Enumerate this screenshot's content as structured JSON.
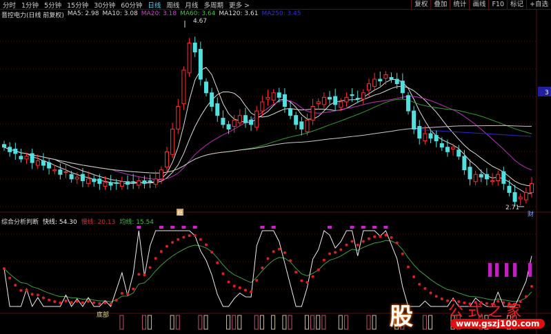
{
  "periods": [
    "分时",
    "1分钟",
    "5分钟",
    "15分钟",
    "30分钟",
    "60分钟",
    "日线",
    "周线",
    "月线",
    "多周期",
    "更多 >"
  ],
  "active_period": "日线",
  "right_tools": [
    "复权",
    "叠加",
    "统计",
    "画线",
    "F10",
    "标记",
    "+自选"
  ],
  "stock_title": "晋控电力(日线 前复权)",
  "ma": [
    {
      "label": "MA5: 2.98",
      "color": "#dddddd"
    },
    {
      "label": "MA10: 3.08",
      "color": "#dddddd"
    },
    {
      "label": "MA20: 3.18",
      "color": "#d040d0"
    },
    {
      "label": "MA60: 3.64",
      "color": "#40c040"
    },
    {
      "label": "MA120: 3.61",
      "color": "#dddddd"
    },
    {
      "label": "MA250: 3.45",
      "color": "#3030e0"
    }
  ],
  "high_label": "4.67",
  "low_label": "2.71",
  "axis_tag": "3",
  "cai_tag": "财",
  "event_tag": "稳",
  "indicator": {
    "name": "综合分析判断",
    "fast": "快线: 54.30",
    "slow": "慢线: 20.13",
    "avg": "均线: 15.54",
    "bottom_label": "底部"
  },
  "watermark": {
    "brand": "股",
    "title": "公式之家",
    "url": "www.gszj100.com"
  },
  "colors": {
    "up": "#ff3030",
    "down": "#50e0e0",
    "grid": "#5a1010"
  },
  "chart_data": {
    "type": "candlestick",
    "closes": [
      3.35,
      3.3,
      3.28,
      3.22,
      3.25,
      3.18,
      3.2,
      3.15,
      3.12,
      3.1,
      3.05,
      3.08,
      3.0,
      3.02,
      2.98,
      3.0,
      2.97,
      2.95,
      2.96,
      2.93,
      2.95,
      2.97,
      2.94,
      2.96,
      2.98,
      2.95,
      2.97,
      3.0,
      3.1,
      3.3,
      3.55,
      3.8,
      4.2,
      4.5,
      4.4,
      4.1,
      3.95,
      3.8,
      3.7,
      3.6,
      3.55,
      3.65,
      3.7,
      3.62,
      3.6,
      3.75,
      3.85,
      3.9,
      3.95,
      3.9,
      3.8,
      3.7,
      3.6,
      3.55,
      3.65,
      3.8,
      3.85,
      3.9,
      3.88,
      3.82,
      3.85,
      3.9,
      3.92,
      3.88,
      3.95,
      4.05,
      4.1,
      4.08,
      4.15,
      4.1,
      4.05,
      3.95,
      3.75,
      3.55,
      3.45,
      3.5,
      3.45,
      3.42,
      3.35,
      3.3,
      3.35,
      3.25,
      3.1,
      3.0,
      3.05,
      3.02,
      3.0,
      2.98,
      3.05,
      2.95,
      2.85,
      2.75,
      2.8,
      2.85,
      2.95
    ],
    "ylim": [
      2.71,
      4.67
    ]
  }
}
